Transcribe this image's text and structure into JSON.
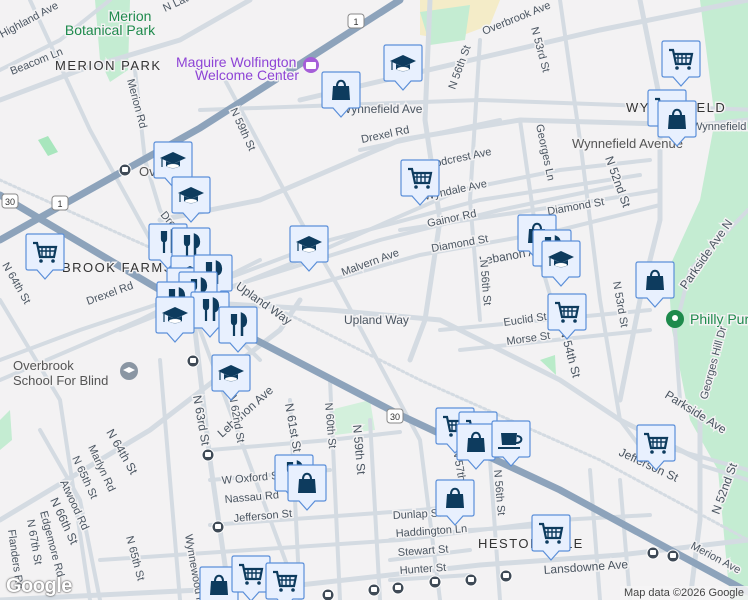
{
  "map": {
    "attribution": "Map data ©2026 Google",
    "logo": "Google",
    "colors": {
      "marker_fill": "#e8f0fe",
      "marker_stroke": "#5b8fd9",
      "icon": "#0d3b5e",
      "highway": "#8da3bb",
      "park": "#b9ebc9"
    },
    "places": {
      "merion_botanical_1": "Merion",
      "merion_botanical_2": "Botanical Park",
      "merion_park": "MERION PARK",
      "maguire_1": "Maguire Wolfington",
      "maguire_2": "Welcome Center",
      "overbrook_farms": "BROOK FARMS",
      "overbrook_school_1": "Overbrook",
      "overbrook_school_2": "School For Blind",
      "wynnefield": "WYNNEFIELD",
      "wynnefield_station": "Wynnefield Avenue",
      "philly_park": "Philly Pur",
      "heston": "HESTONVILLE",
      "overbrook_station": "Ove"
    },
    "streets": {
      "highland": "Highland Ave",
      "beacom": "Beacom Ln",
      "latches": "N Latc",
      "merion_rd": "Merion Rd",
      "n59_top": "N 59th St",
      "overbrook": "Overbrook Ave",
      "wynnefield_ave": "Wynnefield Ave",
      "wynnefield_ave_e": "Wynnefield Ave",
      "drexel_top": "Drexel Rd",
      "drexel_left": "Drexel Rd",
      "drexel_mid": "Drexel Rd",
      "woodcrest": "Woodcrest Ave",
      "wyndale": "Wyndale Ave",
      "gainor": "Gainor Rd",
      "diamond": "Diamond St",
      "diamond_e": "Diamond St",
      "malvern": "Malvern Ave",
      "lebanon_n": "Lebanon Ave",
      "upland": "Upland Way",
      "upland_w": "Upland Way",
      "n53": "N 53rd St",
      "n56_top": "N 56th St",
      "georges": "Georges Ln",
      "n52": "N 52nd St",
      "parkside_n": "Parkside Ave N",
      "n56_mid": "N 56th St",
      "n53_mid": "N 53rd St",
      "euclid": "Euclid St",
      "morse": "Morse St",
      "n54": "N 54th St",
      "parkside": "Parkside Ave",
      "georges_hill": "Georges Hill Dr",
      "jefferson_e": "Jefferson St",
      "n52_s": "N 52nd St",
      "merion_ave": "Merion Ave",
      "n64": "N 64th St",
      "n64_s": "N 64th St",
      "n63": "N 63rd St",
      "lebanon_s": "Lebanon Ave",
      "n61": "N 61st St",
      "n60": "N 60th St",
      "n59_s": "N 59th St",
      "w_oxford": "W Oxford St",
      "nassau": "Nassau Rd",
      "jefferson": "Jefferson St",
      "n66": "N 66th St",
      "n65": "N 65th St",
      "n65_s": "N 65th St",
      "marlyn": "Marlyn Rd",
      "atwood": "Atwood Rd",
      "edgemore": "Edgemore Rd",
      "n67": "N 67th St",
      "flanders": "Flanders Rd",
      "wynnewood": "Wynnewood Rd",
      "n57": "N 57th St",
      "n56_s": "N 56th St",
      "dunlap": "Dunlap St",
      "haddington": "Haddington Ln",
      "stewart": "Stewart St",
      "hunter": "Hunter St",
      "lansdowne": "Lansdowne Ave",
      "n62": "N 62nd St",
      "us1": "1",
      "us1_b": "1",
      "us30": "30",
      "us30_b": "30"
    },
    "markers": [
      "bag",
      "cap",
      "cart",
      "cart",
      "bag",
      "cart",
      "cap",
      "cap",
      "cart",
      "food",
      "food",
      "cap",
      "cap",
      "food",
      "food",
      "food",
      "food",
      "food",
      "cap",
      "cap",
      "cap",
      "bag",
      "food",
      "cap",
      "bag",
      "cart",
      "cart",
      "cart",
      "bag",
      "cup",
      "bag",
      "cart",
      "cart",
      "food",
      "bag",
      "bag",
      "cart",
      "cart"
    ]
  }
}
